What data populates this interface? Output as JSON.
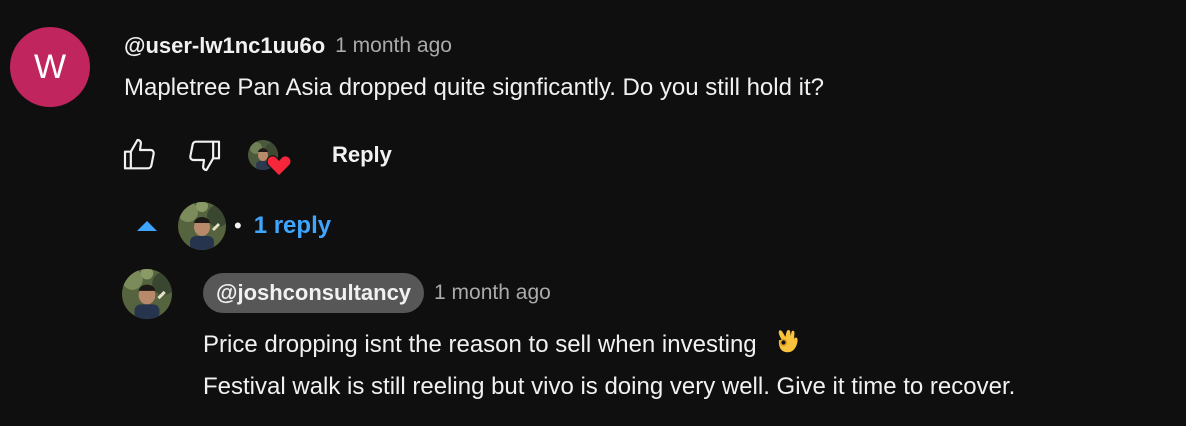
{
  "comment": {
    "avatar_letter": "W",
    "avatar_color": "#c0255e",
    "author": "@user-lw1nc1uu6o",
    "time": "1 month ago",
    "text": "Mapletree Pan Asia dropped quite signficantly. Do you still hold it?",
    "actions": {
      "like_icon": "thumb-up-icon",
      "dislike_icon": "thumb-down-icon",
      "creator_heart_icon": "heart-icon",
      "reply_label": "Reply"
    }
  },
  "replies_toggle": {
    "icon": "caret-up-icon",
    "separator": "•",
    "count_label": "1 reply",
    "color": "#3ea6ff"
  },
  "reply": {
    "author": "@joshconsultancy",
    "time": "1 month ago",
    "text_line1": "Price dropping isnt the reason to sell when investing",
    "emoji_icon": "ok-hand-icon",
    "text_line2": "Festival walk is still reeling but vivo is doing very well. Give it time to recover."
  }
}
